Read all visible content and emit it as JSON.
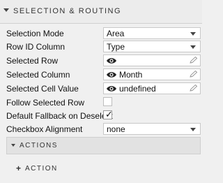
{
  "section": {
    "title": "SELECTION & ROUTING"
  },
  "fields": {
    "selection_mode": {
      "label": "Selection Mode",
      "value": "Area"
    },
    "row_id_column": {
      "label": "Row ID Column",
      "value": "Type"
    },
    "selected_row": {
      "label": "Selected Row",
      "value": ""
    },
    "selected_column": {
      "label": "Selected Column",
      "value": "Month"
    },
    "selected_cell_value": {
      "label": "Selected Cell Value",
      "value": "undefined"
    },
    "follow_selected_row": {
      "label": "Follow Selected Row",
      "checked": false
    },
    "default_fallback": {
      "label": "Default Fallback on Deselect",
      "checked": true,
      "tick": "✓"
    },
    "checkbox_alignment": {
      "label": "Checkbox Alignment",
      "value": "none"
    }
  },
  "actions": {
    "title": "ACTIONS",
    "add_label": "ACTION",
    "add_symbol": "+"
  },
  "icons": {
    "eye": "eye-icon",
    "pencil": "pencil-icon",
    "dropdown": "chevron-down-icon",
    "collapse": "caret-down-icon"
  }
}
